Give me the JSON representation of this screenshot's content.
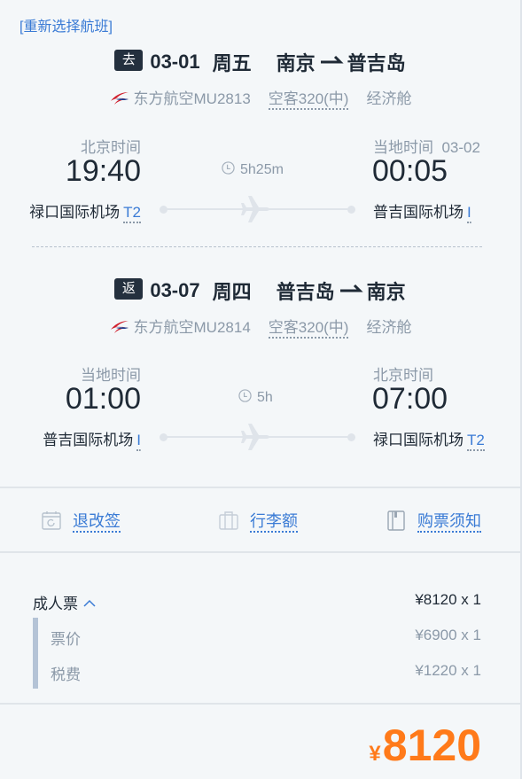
{
  "reselect_link": "[重新选择航班]",
  "segments": [
    {
      "tag": "去",
      "date": "03-01",
      "weekday": "周五",
      "from_city": "南京",
      "to_city": "普吉岛",
      "airline_flight": "东方航空MU2813",
      "aircraft": "空客320(中)",
      "cabin": "经济舱",
      "dep_tz": "北京时间",
      "dep_time": "19:40",
      "dep_airport": "禄口国际机场",
      "dep_terminal": "T2",
      "duration": "5h25m",
      "arr_tz": "当地时间",
      "arr_date": "03-02",
      "arr_time": "00:05",
      "arr_airport": "普吉国际机场",
      "arr_terminal": "I"
    },
    {
      "tag": "返",
      "date": "03-07",
      "weekday": "周四",
      "from_city": "普吉岛",
      "to_city": "南京",
      "airline_flight": "东方航空MU2814",
      "aircraft": "空客320(中)",
      "cabin": "经济舱",
      "dep_tz": "当地时间",
      "dep_time": "01:00",
      "dep_airport": "普吉国际机场",
      "dep_terminal": "I",
      "duration": "5h",
      "arr_tz": "北京时间",
      "arr_time": "07:00",
      "arr_airport": "禄口国际机场",
      "arr_terminal": "T2"
    }
  ],
  "actions": [
    {
      "icon": "calendar-refresh-icon",
      "label": "退改签"
    },
    {
      "icon": "luggage-icon",
      "label": "行李额"
    },
    {
      "icon": "notebook-icon",
      "label": "购票须知"
    }
  ],
  "fare": {
    "adult_label": "成人票",
    "adult_price": "¥8120 x 1",
    "items": [
      {
        "label": "票价",
        "value": "¥6900 x 1"
      },
      {
        "label": "税费",
        "value": "¥1220 x 1"
      }
    ]
  },
  "total": {
    "currency": "¥",
    "amount": "8120"
  },
  "colors": {
    "accent": "#3a7bd5",
    "price": "#ff7a1a",
    "tag_bg": "#24303e"
  }
}
